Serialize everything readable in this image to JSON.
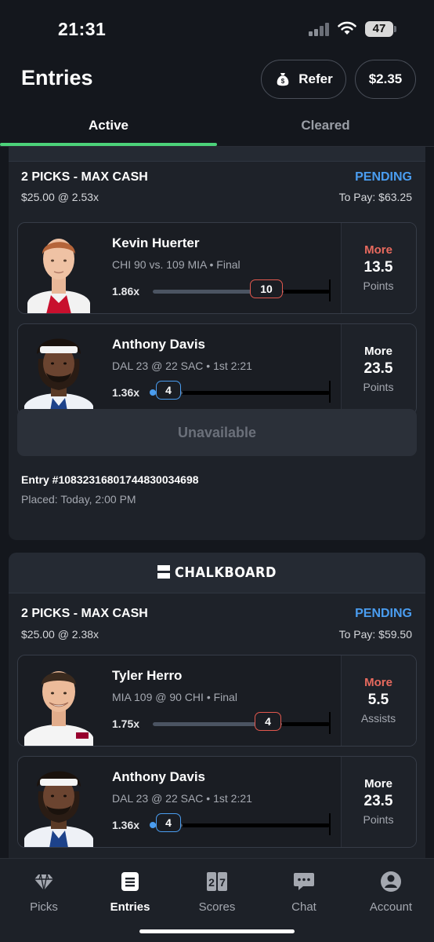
{
  "status_bar": {
    "time": "21:31",
    "battery": "47"
  },
  "header": {
    "title": "Entries",
    "refer_label": "Refer",
    "balance": "$2.35"
  },
  "tabs": [
    {
      "label": "Active"
    },
    {
      "label": "Cleared"
    }
  ],
  "entries": [
    {
      "type": "2 PICKS - MAX CASH",
      "status": "PENDING",
      "stake": "$25.00 @ 2.53x",
      "to_pay": "To Pay: $63.25",
      "picks": [
        {
          "player": "Kevin Huerter",
          "game": "CHI 90 vs. 109 MIA • Final",
          "multiplier": "1.86x",
          "current": "10",
          "direction": "More",
          "line": "13.5",
          "stat": "Points",
          "progress": 0.74
        },
        {
          "player": "Anthony Davis",
          "game": "DAL 23 @ 22 SAC • 1st 2:21",
          "multiplier": "1.36x",
          "current": "4",
          "direction": "More",
          "line": "23.5",
          "stat": "Points",
          "progress": 0.17
        }
      ],
      "unavailable_label": "Unavailable",
      "entry_id": "Entry #1083231680174483003469​8",
      "placed": "Placed: Today, 2:00 PM"
    },
    {
      "brand": "CHALKBOARD",
      "type": "2 PICKS - MAX CASH",
      "status": "PENDING",
      "stake": "$25.00 @ 2.38x",
      "to_pay": "To Pay: $59.50",
      "picks": [
        {
          "player": "Tyler Herro",
          "game": "MIA 109 @ 90 CHI • Final",
          "multiplier": "1.75x",
          "current": "4",
          "direction": "More",
          "line": "5.5",
          "stat": "Assists",
          "progress": 0.73
        },
        {
          "player": "Anthony Davis",
          "game": "DAL 23 @ 22 SAC • 1st 2:21",
          "multiplier": "1.36x",
          "current": "4",
          "direction": "More",
          "line": "23.5",
          "stat": "Points",
          "progress": 0.17
        }
      ]
    }
  ],
  "bottom_nav": [
    {
      "label": "Picks",
      "icon": "diamond-icon"
    },
    {
      "label": "Entries",
      "icon": "list-icon"
    },
    {
      "label": "Scores",
      "icon": "scoreboard-icon"
    },
    {
      "label": "Chat",
      "icon": "chat-icon"
    },
    {
      "label": "Account",
      "icon": "account-icon"
    }
  ],
  "colors": {
    "accent_green": "#4cd27a",
    "pending_blue": "#4a9df0",
    "more_red": "#e86a5e"
  }
}
